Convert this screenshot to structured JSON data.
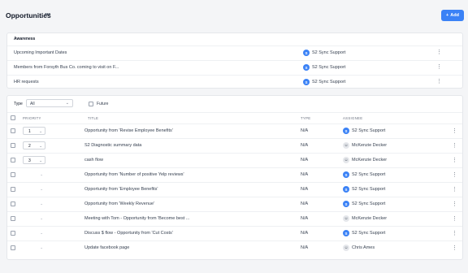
{
  "header": {
    "title": "Opportunities",
    "more_icon": "more-horizontal-icon",
    "add_label": "Add",
    "add_icon": "plus-icon",
    "accent": "#3b82f6"
  },
  "awareness": {
    "title": "Awareness",
    "rows": [
      {
        "name": "Upcoming Important Dates",
        "assignee": "S2 Sync Support"
      },
      {
        "name": "Members from Forsyth Bus Co. coming to visit on F...",
        "assignee": "S2 Sync Support"
      },
      {
        "name": "HR requests",
        "assignee": "S2 Sync Support"
      }
    ]
  },
  "filters": {
    "type_label": "Type",
    "type_value": "All",
    "future_label": "Future"
  },
  "table": {
    "headers": {
      "priority": "PRIORITY",
      "title": "TITLE",
      "type": "TYPE",
      "assignee": "ASSIGNEE"
    },
    "rows": [
      {
        "priority": "1",
        "title": "Opportunity from 'Revise Employee Benefits'",
        "type": "N/A",
        "assignee": "S2 Sync Support",
        "avatar": "s2"
      },
      {
        "priority": "2",
        "title": "S2 Diagnostic summary data",
        "type": "N/A",
        "assignee": "McKenzie Decker",
        "avatar": "person"
      },
      {
        "priority": "3",
        "title": "cash flow",
        "type": "N/A",
        "assignee": "McKenzie Decker",
        "avatar": "person"
      },
      {
        "priority": "",
        "title": "Opportunity from 'Number of positive Yelp reviews'",
        "type": "N/A",
        "assignee": "S2 Sync Support",
        "avatar": "s2"
      },
      {
        "priority": "",
        "title": "Opportunity from 'Employee Benefits'",
        "type": "N/A",
        "assignee": "S2 Sync Support",
        "avatar": "s2"
      },
      {
        "priority": "",
        "title": "Opportunity from 'Weekly Revenue'",
        "type": "N/A",
        "assignee": "S2 Sync Support",
        "avatar": "s2"
      },
      {
        "priority": "",
        "title": "Meeting with Tom - Opportunity from 'Become best ...",
        "type": "N/A",
        "assignee": "McKenzie Decker",
        "avatar": "person"
      },
      {
        "priority": "",
        "title": "Discuss $ flow - Opportunity from 'Cut Costs'",
        "type": "N/A",
        "assignee": "S2 Sync Support",
        "avatar": "s2"
      },
      {
        "priority": "",
        "title": "Update facebook page",
        "type": "N/A",
        "assignee": "Chris Ames",
        "avatar": "person"
      }
    ]
  }
}
